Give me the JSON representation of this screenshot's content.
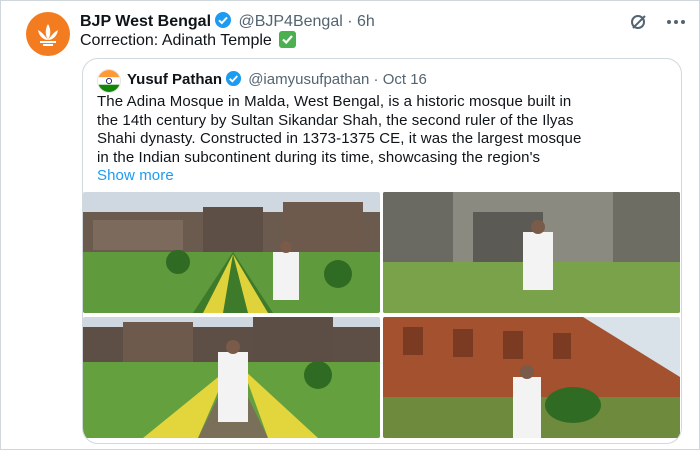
{
  "tweet": {
    "author_name": "BJP West Bengal",
    "handle": "@BJP4Bengal",
    "separator": "·",
    "time": "6h",
    "text": "Correction: Adinath Temple",
    "emoji_icon": "check-mark-button-icon"
  },
  "quoted": {
    "author_name": "Yusuf Pathan",
    "handle": "@iamyusufpathan",
    "separator": "·",
    "date": "Oct 16",
    "lines": [
      "The Adina Mosque in Malda, West Bengal, is a historic mosque built in",
      "the 14th century by Sultan Sikandar Shah, the second ruler of the Ilyas",
      "Shahi dynasty. Constructed in 1373-1375 CE, it was the largest mosque",
      "in the Indian subcontinent during its time, showcasing the region's"
    ],
    "show_more": "Show more"
  },
  "colors": {
    "accent": "#1d9bf0",
    "verified": "#1d9bf0",
    "bjp_orange": "#f47c20",
    "muted": "#536471",
    "check_green": "#4caf50"
  },
  "icons": {
    "grok": "grok-icon",
    "more": "more-options-icon"
  }
}
